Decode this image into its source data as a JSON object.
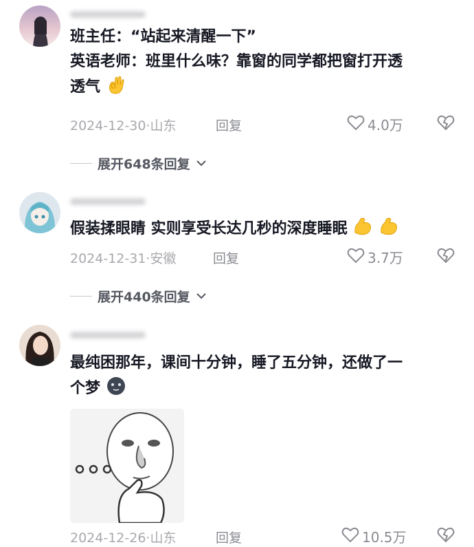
{
  "comments": [
    {
      "lines": [
        "班主任：“站起来清醒一下”",
        "英语老师：班里什么味？靠窗的同学都把窗打开透",
        "透气"
      ],
      "emoji": [
        "ok-hand-emoji"
      ],
      "date": "2024-12-30·山东",
      "reply_label": "回复",
      "likes": "4.0万",
      "expand_label": "展开648条回复"
    },
    {
      "lines": [
        "假装揉眼睛 实则享受长达几秒的深度睡眠"
      ],
      "emoji": [
        "flexed-arm-emoji",
        "flexed-arm-emoji"
      ],
      "date": "2024-12-31·安徽",
      "reply_label": "回复",
      "likes": "3.7万",
      "expand_label": "展开440条回复"
    },
    {
      "lines": [
        "最纯困那年，课间十分钟，睡了五分钟，还做了一",
        "个梦"
      ],
      "emoji": [
        "sleepy-face-emoji"
      ],
      "date": "2024-12-26·山东",
      "reply_label": "回复",
      "likes": "10.5万",
      "meme": "thinking-meme-image"
    }
  ],
  "colors": {
    "text": "#161823",
    "meta": "#a8a8ad",
    "icon": "#8a8b91",
    "expand": "#555861"
  }
}
